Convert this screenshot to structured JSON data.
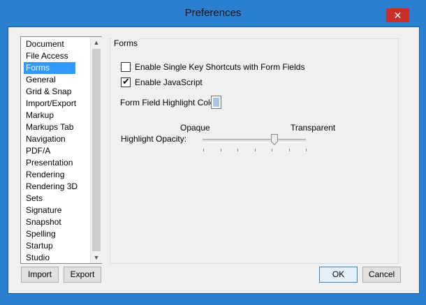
{
  "window": {
    "title": "Preferences",
    "close_glyph": "✕"
  },
  "categories": {
    "items": [
      "Document",
      "File Access",
      "Forms",
      "General",
      "Grid & Snap",
      "Import/Export",
      "Markup",
      "Markups Tab",
      "Navigation",
      "PDF/A",
      "Presentation",
      "Rendering",
      "Rendering 3D",
      "Sets",
      "Signature",
      "Snapshot",
      "Spelling",
      "Startup",
      "Studio"
    ],
    "selected": "Forms"
  },
  "panel": {
    "caption": "Forms",
    "single_key_shortcuts": {
      "label": "Enable Single Key Shortcuts with Form Fields",
      "checked": false
    },
    "javascript": {
      "label": "Enable JavaScript",
      "checked": true
    },
    "highlight_color": {
      "label": "Form Field Highlight Color:",
      "swatch_color": "#a8c5e6"
    },
    "highlight_opacity": {
      "label": "Highlight Opacity:",
      "min_label": "Opaque",
      "max_label": "Transparent",
      "value_fraction": 0.7
    }
  },
  "buttons": {
    "import": "Import",
    "export": "Export",
    "ok": "OK",
    "cancel": "Cancel"
  },
  "colors": {
    "window_frame": "#2a80cf",
    "selection": "#3399ff",
    "close_button": "#c9302c"
  }
}
